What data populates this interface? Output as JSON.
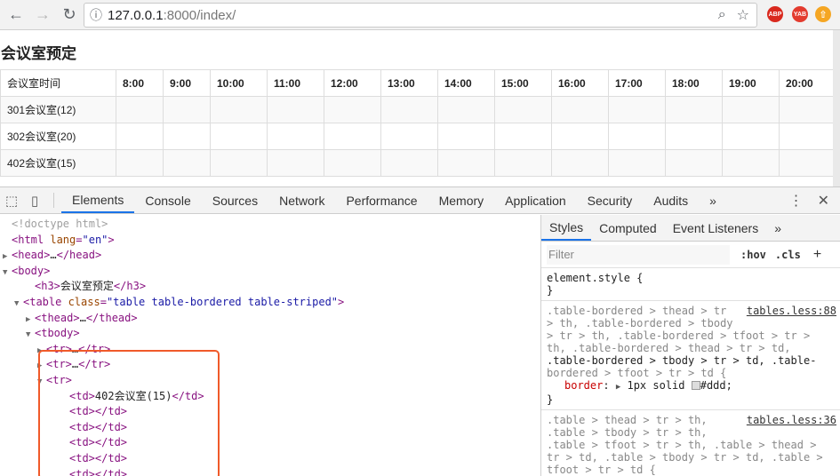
{
  "browser": {
    "url_host": "127.0.0.1",
    "url_rest": ":8000/index/",
    "ext_abp": "ABP",
    "ext_yab": "YAB"
  },
  "page": {
    "title": "会议室预定",
    "header_first": "会议室时间",
    "hours": [
      "8:00",
      "9:00",
      "10:00",
      "11:00",
      "12:00",
      "13:00",
      "14:00",
      "15:00",
      "16:00",
      "17:00",
      "18:00",
      "19:00",
      "20:00"
    ],
    "rooms": [
      "301会议室(12)",
      "302会议室(20)",
      "402会议室(15)"
    ]
  },
  "devtools": {
    "tabs": [
      "Elements",
      "Console",
      "Sources",
      "Network",
      "Performance",
      "Memory",
      "Application",
      "Security",
      "Audits"
    ],
    "active_tab": "Elements",
    "more": "»",
    "elements_lines": [
      {
        "indent": 1,
        "tri": "",
        "html": "doctype"
      },
      {
        "indent": 1,
        "tri": "",
        "html": "htmlopen"
      },
      {
        "indent": 1,
        "tri": "▶",
        "html": "head"
      },
      {
        "indent": 1,
        "tri": "▼",
        "html": "body"
      },
      {
        "indent": 3,
        "tri": "",
        "html": "h3"
      },
      {
        "indent": 2,
        "tri": "▼",
        "html": "table"
      },
      {
        "indent": 3,
        "tri": "▶",
        "html": "thead"
      },
      {
        "indent": 3,
        "tri": "▼",
        "html": "tbody"
      },
      {
        "indent": 4,
        "tri": "▶",
        "html": "trc"
      },
      {
        "indent": 4,
        "tri": "▶",
        "html": "trc"
      },
      {
        "indent": 4,
        "tri": "▼",
        "html": "tropen"
      },
      {
        "indent": 6,
        "tri": "",
        "html": "tdroom"
      },
      {
        "indent": 6,
        "tri": "",
        "html": "td"
      },
      {
        "indent": 6,
        "tri": "",
        "html": "td"
      },
      {
        "indent": 6,
        "tri": "",
        "html": "td"
      },
      {
        "indent": 6,
        "tri": "",
        "html": "td"
      },
      {
        "indent": 6,
        "tri": "",
        "html": "td"
      }
    ],
    "code": {
      "doctype": "<!doctype html>",
      "html_lang_attr": "lang",
      "html_lang_val": "\"en\"",
      "h3_text": "会议室预定",
      "table_class_attr": "class",
      "table_class_val": "\"table table-bordered table-striped\"",
      "td_room_text": "402会议室(15)"
    },
    "styles_tabs": [
      "Styles",
      "Computed",
      "Event Listeners"
    ],
    "filter_placeholder": "Filter",
    "hov": ":hov",
    "cls": ".cls",
    "element_style": "element.style {",
    "close_brace": "}",
    "rule1_src": "tables.less:88",
    "rule1_lines": [
      ".table-bordered > thead > tr",
      "> th, .table-bordered > tbody",
      "> tr > th, .table-bordered > tfoot > tr >",
      "th, .table-bordered > thead > tr > td,",
      ".table-bordered > tbody > tr > td, .table-",
      "bordered > tfoot > tr > td {"
    ],
    "rule1_prop": "border",
    "rule1_value": "1px solid",
    "rule1_color": "#ddd;",
    "rule2_src": "tables.less:36",
    "rule2_lines": [
      ".table > thead > tr > th,",
      ".table > tbody > tr > th,",
      ".table > tfoot > tr > th, .table > thead >",
      "tr > td, .table > tbody > tr > td, .table >",
      "tfoot > tr > td {"
    ]
  }
}
